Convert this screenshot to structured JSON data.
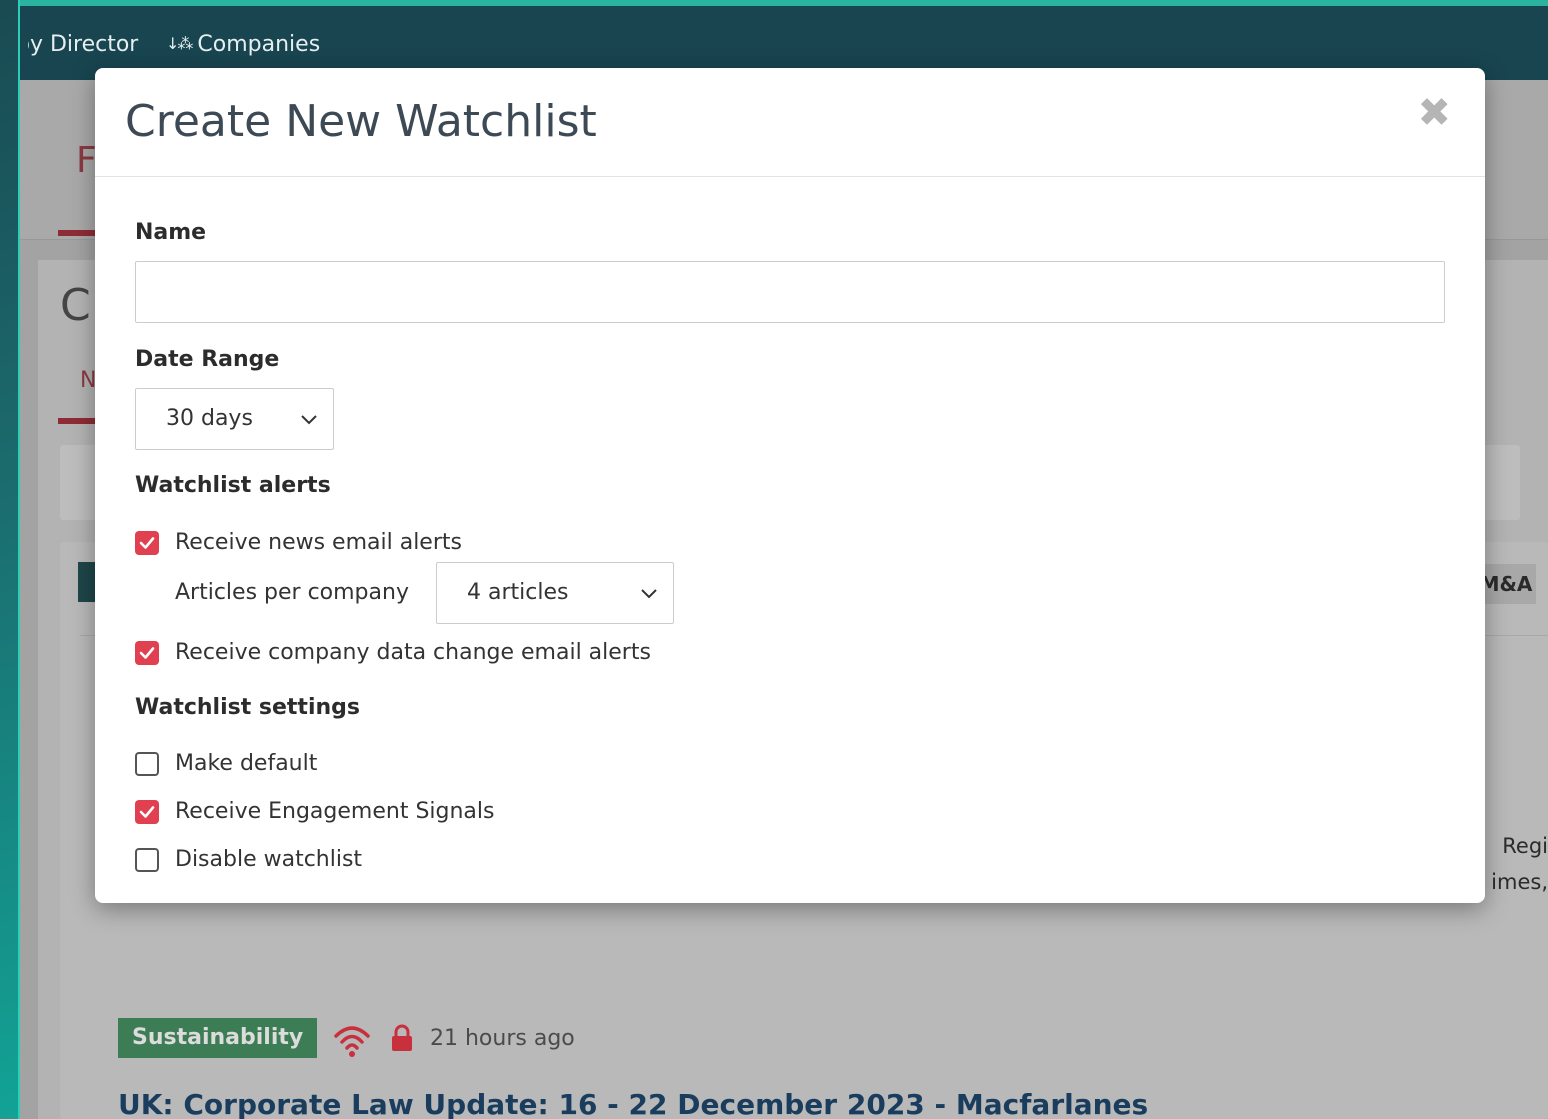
{
  "topbar": {
    "director_label": "by Director",
    "companies_label": "Companies",
    "sort_icon": "sort-az-icon"
  },
  "background": {
    "tag_ma": "M&A",
    "right_text_1": "Regi",
    "right_text_2": "imes,",
    "tag_sustainability": "Sustainability",
    "time_ago": "21 hours ago",
    "article_title": "UK: Corporate Law Update: 16 - 22 December 2023 - Macfarlanes"
  },
  "modal": {
    "title": "Create New Watchlist",
    "close_icon": "close-icon",
    "name_label": "Name",
    "name_value": "",
    "date_range_label": "Date Range",
    "date_range_value": "30 days",
    "alerts_heading": "Watchlist alerts",
    "news_alerts_label": "Receive news email alerts",
    "news_alerts_checked": true,
    "articles_per_company_label": "Articles per company",
    "articles_per_company_value": "4 articles",
    "data_change_label": "Receive company data change email alerts",
    "data_change_checked": true,
    "settings_heading": "Watchlist settings",
    "make_default_label": "Make default",
    "make_default_checked": false,
    "engagement_label": "Receive Engagement Signals",
    "engagement_checked": true,
    "disable_label": "Disable watchlist",
    "disable_checked": false
  },
  "colors": {
    "accent_red": "#e04050",
    "topbar": "#184550",
    "teal": "#2ab39e"
  }
}
